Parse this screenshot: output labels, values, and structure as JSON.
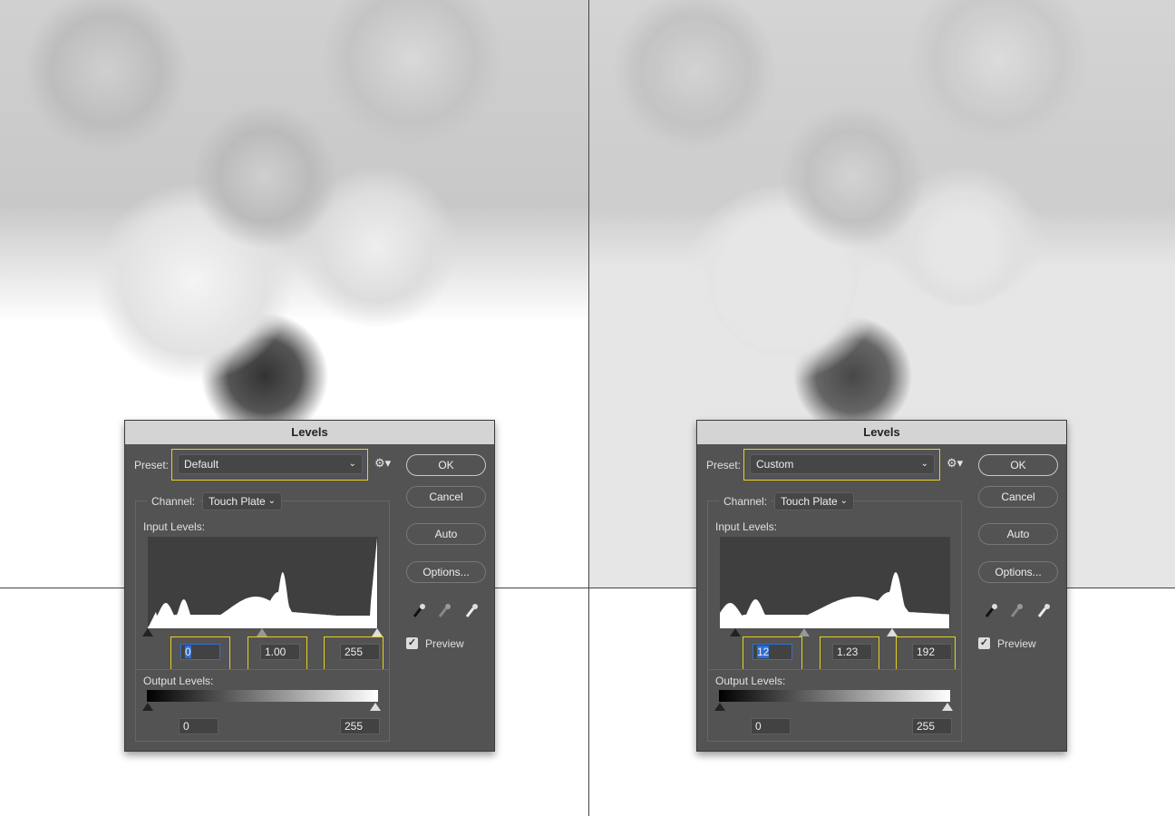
{
  "dialogs": [
    {
      "title": "Levels",
      "preset_label": "Preset:",
      "preset": "Default",
      "channel_label": "Channel:",
      "channel": "Touch Plate",
      "input_label": "Input Levels:",
      "input_black": "0",
      "input_gamma": "1.00",
      "input_white": "255",
      "output_label": "Output Levels:",
      "output_black": "0",
      "output_white": "255",
      "ok": "OK",
      "cancel": "Cancel",
      "auto": "Auto",
      "options": "Options...",
      "preview_label": "Preview",
      "preview_checked": true,
      "input_black_value": 0,
      "input_gamma_value": 1.0,
      "input_white_value": 255
    },
    {
      "title": "Levels",
      "preset_label": "Preset:",
      "preset": "Custom",
      "channel_label": "Channel:",
      "channel": "Touch Plate",
      "input_label": "Input Levels:",
      "input_black": "12",
      "input_gamma": "1.23",
      "input_white": "192",
      "output_label": "Output Levels:",
      "output_black": "0",
      "output_white": "255",
      "ok": "OK",
      "cancel": "Cancel",
      "auto": "Auto",
      "options": "Options...",
      "preview_label": "Preview",
      "preview_checked": true,
      "input_black_value": 12,
      "input_gamma_value": 1.23,
      "input_white_value": 192
    }
  ],
  "colors": {
    "highlight": "#e6d21a",
    "dialog_bg": "#535353",
    "selection": "#2f6fd6"
  },
  "icons": {
    "gear": "gear-icon",
    "eyedroppers": [
      "black-eyedropper-icon",
      "gray-eyedropper-icon",
      "white-eyedropper-icon"
    ]
  }
}
